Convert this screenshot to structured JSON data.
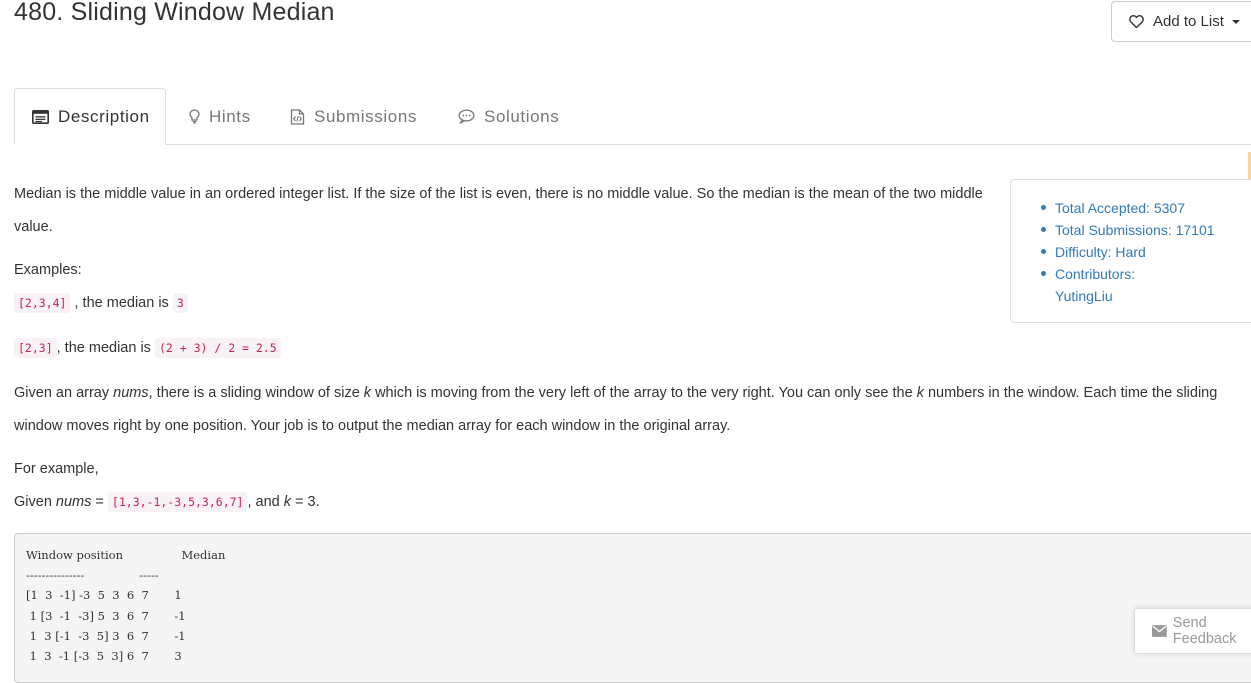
{
  "problem": {
    "title": "480. Sliding Window Median"
  },
  "toolbar": {
    "add_to_list_label": "Add to List"
  },
  "tabs": [
    {
      "label": "Description",
      "icon": "description-icon",
      "active": true
    },
    {
      "label": "Hints",
      "icon": "lightbulb-icon",
      "active": false
    },
    {
      "label": "Submissions",
      "icon": "code-file-icon",
      "active": false
    },
    {
      "label": "Solutions",
      "icon": "comment-icon",
      "active": false
    }
  ],
  "stats": {
    "accepted": "Total Accepted: 5307",
    "submissions": "Total Submissions: 17101",
    "difficulty": "Difficulty: Hard",
    "contributors_label": "Contributors:",
    "contributor": "YutingLiu"
  },
  "description": {
    "intro": "Median is the middle value in an ordered integer list. If the size of the list is even, there is no middle value. So the median is the mean of the two middle value.",
    "examples_label": "Examples:",
    "ex1_code": "[2,3,4]",
    "ex1_text": " , the median is ",
    "ex1_result": "3",
    "ex2_code": "[2,3]",
    "ex2_text": ", the median is ",
    "ex2_result": "(2 + 3) / 2 = 2.5",
    "para1_a": "Given an array ",
    "para1_nums": "nums",
    "para1_b": ", there is a sliding window of size ",
    "para1_k": "k",
    "para1_c": " which is moving from the very left of the array to the very right. You can only see the ",
    "para1_k2": "k",
    "para1_d": " numbers in the window. Each time the sliding",
    "para1_line2": "window moves right by one position. Your job is to output the median array for each window in the original array.",
    "for_example": "For example,",
    "given_a": "Given ",
    "given_nums": "nums",
    "given_eq": " = ",
    "given_code": "[1,3,-1,-3,5,3,6,7]",
    "given_b": ", and ",
    "given_k": "k",
    "given_c": " = 3."
  },
  "example_block": "Window position                Median\n---------------               -----\n[1  3  -1] -3  5  3  6  7       1\n 1 [3  -1  -3] 5  3  6  7       -1\n 1  3 [-1  -3  5] 3  6  7       -1\n 1  3  -1 [-3  5  3] 6  7       3",
  "feedback": {
    "label": "Send Feedback"
  },
  "colors": {
    "link": "#337ab7",
    "code_text": "#c7254e",
    "code_bg": "#f9f2f4"
  }
}
